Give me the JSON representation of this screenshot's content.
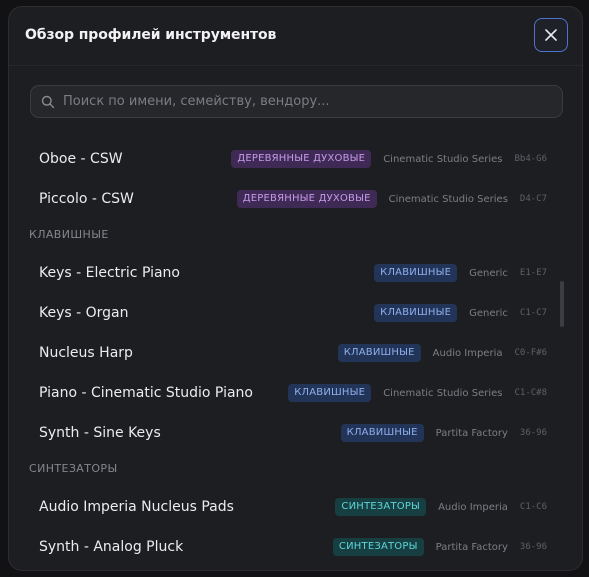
{
  "dialog": {
    "title": "Обзор профилей инструментов",
    "close_icon": "close-icon"
  },
  "search": {
    "placeholder": "Поиск по имени, семейству, вендору...",
    "value": ""
  },
  "colors": {
    "woodwinds_badge": "#3f2a55",
    "keys_badge": "#223457",
    "synth_badge": "#173f42",
    "close_border": "#4f72d0"
  },
  "items": [
    {
      "name": "Oboe - CSW",
      "family": "ДЕРЕВЯННЫЕ ДУХОВЫЕ",
      "vendor": "Cinematic Studio Series",
      "range": "Bb4-G6"
    },
    {
      "name": "Piccolo - CSW",
      "family": "ДЕРЕВЯННЫЕ ДУХОВЫЕ",
      "vendor": "Cinematic Studio Series",
      "range": "D4-C7"
    }
  ],
  "sections": [
    {
      "title": "КЛАВИШНЫЕ",
      "items": [
        {
          "name": "Keys - Electric Piano",
          "family": "КЛАВИШНЫЕ",
          "vendor": "Generic",
          "range": "E1-E7"
        },
        {
          "name": "Keys - Organ",
          "family": "КЛАВИШНЫЕ",
          "vendor": "Generic",
          "range": "C1-C7"
        },
        {
          "name": "Nucleus Harp",
          "family": "КЛАВИШНЫЕ",
          "vendor": "Audio Imperia",
          "range": "C0-F#6"
        },
        {
          "name": "Piano - Cinematic Studio Piano",
          "family": "КЛАВИШНЫЕ",
          "vendor": "Cinematic Studio Series",
          "range": "C1-C#8"
        },
        {
          "name": "Synth - Sine Keys",
          "family": "КЛАВИШНЫЕ",
          "vendor": "Partita Factory",
          "range": "36-96"
        }
      ]
    },
    {
      "title": "СИНТЕЗАТОРЫ",
      "items": [
        {
          "name": "Audio Imperia Nucleus Pads",
          "family": "СИНТЕЗАТОРЫ",
          "vendor": "Audio Imperia",
          "range": "C1-C6"
        },
        {
          "name": "Synth - Analog Pluck",
          "family": "СИНТЕЗАТОРЫ",
          "vendor": "Partita Factory",
          "range": "36-96"
        }
      ]
    }
  ]
}
